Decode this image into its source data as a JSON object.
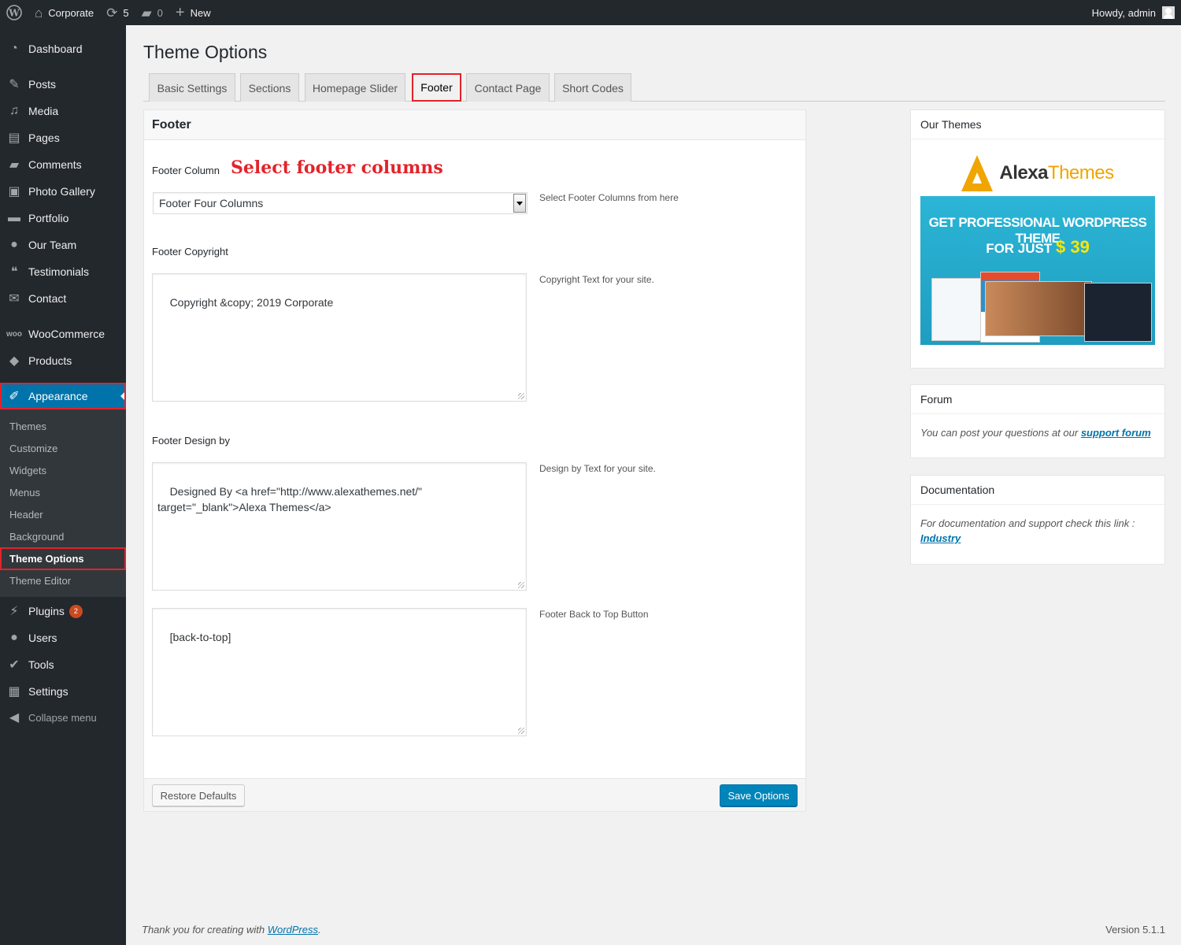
{
  "adminbar": {
    "site_name": "Corporate",
    "updates_count": "5",
    "comments_count": "0",
    "new_label": "New",
    "greeting": "Howdy, admin"
  },
  "sidebar": {
    "items": [
      {
        "label": "Dashboard",
        "icon": "dashboard-icon"
      },
      {
        "label": "Posts",
        "icon": "pin-icon"
      },
      {
        "label": "Media",
        "icon": "media-icon"
      },
      {
        "label": "Pages",
        "icon": "pages-icon"
      },
      {
        "label": "Comments",
        "icon": "comments-icon"
      },
      {
        "label": "Photo Gallery",
        "icon": "gallery-icon"
      },
      {
        "label": "Portfolio",
        "icon": "portfolio-icon"
      },
      {
        "label": "Our Team",
        "icon": "team-icon"
      },
      {
        "label": "Testimonials",
        "icon": "quote-icon"
      },
      {
        "label": "Contact",
        "icon": "mail-icon"
      },
      {
        "label": "WooCommerce",
        "icon": "woo-icon"
      },
      {
        "label": "Products",
        "icon": "box-icon"
      },
      {
        "label": "Appearance",
        "icon": "brush-icon"
      },
      {
        "label": "Plugins",
        "icon": "plugin-icon",
        "badge": "2"
      },
      {
        "label": "Users",
        "icon": "user-icon"
      },
      {
        "label": "Tools",
        "icon": "wrench-icon"
      },
      {
        "label": "Settings",
        "icon": "settings-icon"
      },
      {
        "label": "Collapse menu",
        "icon": "collapse-icon"
      }
    ],
    "submenu": [
      "Themes",
      "Customize",
      "Widgets",
      "Menus",
      "Header",
      "Background",
      "Theme Options",
      "Theme Editor"
    ]
  },
  "page_title": "Theme Options",
  "tabs": [
    "Basic Settings",
    "Sections",
    "Homepage Slider",
    "Footer",
    "Contact Page",
    "Short Codes"
  ],
  "panel": {
    "title": "Footer",
    "footer_column_label": "Footer Column",
    "annotation": "Select footer columns",
    "footer_column_value": "Footer Four Columns",
    "footer_column_hint": "Select Footer Columns from here",
    "copyright_label": "Footer Copyright",
    "copyright_value": "Copyright &copy; 2019 Corporate",
    "copyright_hint": "Copyright Text for your site.",
    "design_label": "Footer Design by",
    "design_value": "Designed By <a href=\"http://www.alexathemes.net/\"\ntarget=\"_blank\">Alexa Themes</a>",
    "design_hint": "Design by Text for your site.",
    "backtop_value": "[back-to-top]",
    "backtop_hint": "Footer Back to Top Button",
    "restore_label": "Restore Defaults",
    "save_label": "Save Options"
  },
  "widgets": {
    "themes_title": "Our Themes",
    "promo_brand_a": "Alexa",
    "promo_brand_b": "Themes",
    "promo_line1": "GET PROFESSIONAL WORDPRESS THEME",
    "promo_line2": "FOR JUST",
    "promo_price": "$ 39",
    "forum_title": "Forum",
    "forum_text": "You can post your questions at our ",
    "forum_link": "support forum",
    "docs_title": "Documentation",
    "docs_text": "For documentation and support check this link : ",
    "docs_link": "Industry"
  },
  "footer": {
    "thanks_text": "Thank you for creating with ",
    "thanks_link": "WordPress",
    "thanks_end": ".",
    "version": "Version 5.1.1"
  },
  "colors": {
    "admin_dark": "#23282d",
    "accent_blue": "#0073aa",
    "highlight_red": "#e2232a"
  }
}
